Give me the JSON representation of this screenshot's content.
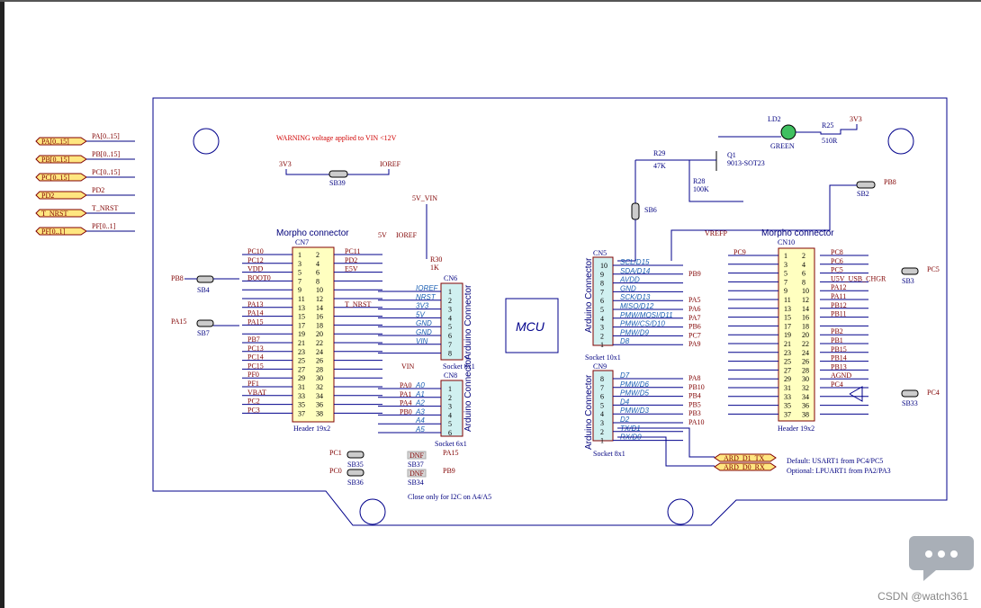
{
  "ports": [
    "PA[0..15]",
    "PB[0..15]",
    "PC[0..15]",
    "PD2",
    "T_NRST",
    "PF[0..1]"
  ],
  "port_nets": [
    "PA[0..15]",
    "PB[0..15]",
    "PC[0..15]",
    "PD2",
    "T_NRST",
    "PF[0..1]"
  ],
  "warning": "WARNING voltage applied to VIN <12V",
  "mcu": "MCU",
  "cn7": {
    "title": "Morpho connector",
    "ref": "CN7",
    "footer": "Header 19x2",
    "left_nets": [
      "PC10",
      "PC12",
      "VDD",
      "BOOT0",
      "",
      "",
      "PA13",
      "PA14",
      "PA15",
      "",
      "PB7",
      "PC13",
      "PC14",
      "PC15",
      "PF0",
      "PF1",
      "VBAT",
      "PC2",
      "PC3"
    ],
    "right_nets": [
      "PC11",
      "PD2",
      "E5V",
      "",
      "",
      "",
      "T_NRST",
      "",
      "",
      "",
      "",
      "",
      "",
      "",
      "",
      "",
      "",
      "",
      ""
    ]
  },
  "cn6": {
    "ref": "CN6",
    "title": "Arduino Connector",
    "footer": "Socket 8x1",
    "pins": [
      "IOREF",
      "NRST",
      "3V3",
      "5V",
      "GND",
      "GND",
      "VIN",
      ""
    ]
  },
  "cn8": {
    "ref": "CN8",
    "title": "Arduino Connector",
    "footer": "Socket 6x1",
    "pins": [
      "A0",
      "A1",
      "A2",
      "A3",
      "A4",
      "A5"
    ],
    "nets": [
      "PA0",
      "PA1",
      "PA4",
      "PB0"
    ]
  },
  "cn5": {
    "ref": "CN5",
    "title": "Arduino Connector",
    "footer": "Socket 10x1",
    "pins": [
      "SCL/D15",
      "SDA/D14",
      "AVDD",
      "GND",
      "SCK/D13",
      "MISO/D12",
      "PMW/MOSI/D11",
      "PMW/CS/D10",
      "PMW/D9",
      "D8"
    ],
    "nets": [
      "",
      "PB9",
      "",
      "",
      "PA5",
      "PA6",
      "PA7",
      "PB6",
      "PC7",
      "PA9"
    ]
  },
  "cn9": {
    "ref": "CN9",
    "title": "Arduino Connector",
    "footer": "Socket 8x1",
    "pins": [
      "D7",
      "PMW/D6",
      "PMW/D5",
      "D4",
      "PMW/D3",
      "D2",
      "TX/D1",
      "RX/D0"
    ],
    "nets": [
      "PA8",
      "PB10",
      "PB4",
      "PB5",
      "PB3",
      "PA10",
      "",
      ""
    ]
  },
  "cn10": {
    "title": "Morpho connector",
    "ref": "CN10",
    "footer": "Header 19x2",
    "left_nets": [
      "PC9",
      "",
      "",
      "",
      "",
      "",
      "",
      "",
      "",
      "",
      "",
      "",
      "",
      "",
      "",
      "",
      "",
      "",
      ""
    ],
    "right_nets": [
      "PC8",
      "PC6",
      "PC5",
      "U5V_USB_CHGR",
      "PA12",
      "PA11",
      "PB12",
      "PB11",
      "",
      "PB2",
      "PB1",
      "PB15",
      "PB14",
      "PB13",
      "AGND",
      "PC4",
      "",
      "",
      ""
    ]
  },
  "parts": {
    "sb39": "SB39",
    "sb4": "SB4",
    "sb7": "SB7",
    "sb35": "SB35",
    "sb36": "SB36",
    "sb37": "SB37",
    "sb34": "SB34",
    "sb6": "SB6",
    "sb2": "SB2",
    "sb3": "SB3",
    "sb33": "SB33",
    "r30": "R30",
    "r30v": "1K",
    "r29": "R29",
    "r29v": "47K",
    "r28": "R28",
    "r28v": "100K",
    "r25": "R25",
    "r25v": "510R",
    "q1": "Q1",
    "q1v": "9013-SOT23",
    "ld2": "LD2",
    "ld2v": "GREEN",
    "dnf": "DNF"
  },
  "nets": {
    "v3a": "3V3",
    "ioref": "IOREF",
    "v5vin": "5V_VIN",
    "v5": "5V",
    "ioref2": "IOREF",
    "vin": "VIN",
    "vrefp": "VREFP",
    "v3b": "3V3",
    "pb8": "PB8",
    "pb8b": "PB8",
    "pc1": "PC1",
    "pc0": "PC0",
    "pa15b": "PA15",
    "pb9b": "PB9",
    "pc5b": "PC5",
    "pc4b": "PC4"
  },
  "ard_tx": "ARD_D1_TX",
  "ard_rx": "ARD_D0_RX",
  "note_default": "Default: USART1 from PC4/PC5",
  "note_optional": "Optional: LPUART1 from PA2/PA3",
  "note_i2c": "Close only for I2C on A4/A5",
  "watermark": "CSDN @watch361"
}
